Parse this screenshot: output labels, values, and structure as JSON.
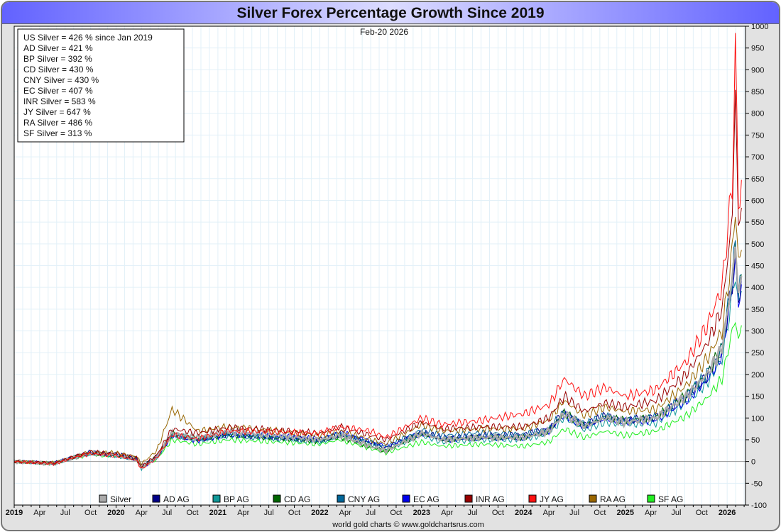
{
  "chart_data": {
    "type": "line",
    "title": "Silver Forex Percentage Growth Since 2019",
    "date_label": "Feb-20  2026",
    "footer": "world gold charts © www.goldchartsrus.com",
    "ylim": [
      -100,
      1000
    ],
    "y_ticks": [
      -100,
      -50,
      0,
      50,
      100,
      150,
      200,
      250,
      300,
      350,
      400,
      450,
      500,
      550,
      600,
      650,
      700,
      750,
      800,
      850,
      900,
      950,
      1000
    ],
    "x_range": [
      2019.0,
      2026.18
    ],
    "x_ticks": [
      {
        "v": 2019.0,
        "l": "2019",
        "b": true
      },
      {
        "v": 2019.25,
        "l": "Apr"
      },
      {
        "v": 2019.5,
        "l": "Jul"
      },
      {
        "v": 2019.75,
        "l": "Oct"
      },
      {
        "v": 2020.0,
        "l": "2020",
        "b": true
      },
      {
        "v": 2020.25,
        "l": "Apr"
      },
      {
        "v": 2020.5,
        "l": "Jul"
      },
      {
        "v": 2020.75,
        "l": "Oct"
      },
      {
        "v": 2021.0,
        "l": "2021",
        "b": true
      },
      {
        "v": 2021.25,
        "l": "Apr"
      },
      {
        "v": 2021.5,
        "l": "Jul"
      },
      {
        "v": 2021.75,
        "l": "Oct"
      },
      {
        "v": 2022.0,
        "l": "2022",
        "b": true
      },
      {
        "v": 2022.25,
        "l": "Apr"
      },
      {
        "v": 2022.5,
        "l": "Jul"
      },
      {
        "v": 2022.75,
        "l": "Oct"
      },
      {
        "v": 2023.0,
        "l": "2023",
        "b": true
      },
      {
        "v": 2023.25,
        "l": "Apr"
      },
      {
        "v": 2023.5,
        "l": "Jul"
      },
      {
        "v": 2023.75,
        "l": "Oct"
      },
      {
        "v": 2024.0,
        "l": "2024",
        "b": true
      },
      {
        "v": 2024.25,
        "l": "Apr"
      },
      {
        "v": 2024.5,
        "l": "Jul"
      },
      {
        "v": 2024.75,
        "l": "Oct"
      },
      {
        "v": 2025.0,
        "l": "2025",
        "b": true
      },
      {
        "v": 2025.25,
        "l": "Apr"
      },
      {
        "v": 2025.5,
        "l": "Jul"
      },
      {
        "v": 2025.75,
        "l": "Oct"
      },
      {
        "v": 2026.0,
        "l": "2026",
        "b": true
      }
    ],
    "info_box": [
      "US Silver = 426 % since Jan 2019",
      "AD Silver = 421 %",
      "BP Silver = 392 %",
      "CD Silver = 430 %",
      "CNY Silver = 430 %",
      "EC Silver = 407 %",
      "INR Silver = 583 %",
      "JY Silver = 647 %",
      "RA Silver = 486 %",
      "SF Silver = 313 %"
    ],
    "x": [
      2019.0,
      2019.4,
      2019.6,
      2019.75,
      2020.0,
      2020.2,
      2020.25,
      2020.4,
      2020.55,
      2020.8,
      2021.1,
      2021.6,
      2022.0,
      2022.2,
      2022.5,
      2022.65,
      2023.0,
      2023.2,
      2023.6,
      2024.0,
      2024.25,
      2024.4,
      2024.6,
      2024.8,
      2025.0,
      2025.3,
      2025.6,
      2025.8,
      2025.95,
      2026.05,
      2026.08,
      2026.11,
      2026.14
    ],
    "series": [
      {
        "name": "SF AG",
        "color": "#22ee22",
        "values": [
          0,
          -6,
          8,
          16,
          12,
          4,
          -14,
          5,
          50,
          40,
          50,
          45,
          40,
          50,
          30,
          20,
          45,
          35,
          40,
          35,
          45,
          75,
          55,
          70,
          60,
          70,
          105,
          145,
          190,
          300,
          330,
          270,
          313
        ]
      },
      {
        "name": "BP AG",
        "color": "#119999",
        "values": [
          0,
          -5,
          10,
          18,
          13,
          3,
          -16,
          8,
          62,
          50,
          60,
          52,
          45,
          62,
          40,
          28,
          60,
          45,
          50,
          50,
          65,
          100,
          72,
          90,
          85,
          88,
          135,
          180,
          235,
          380,
          440,
          350,
          392
        ]
      },
      {
        "name": "EC AG",
        "color": "#0000ee",
        "values": [
          0,
          -4,
          11,
          20,
          15,
          5,
          -15,
          8,
          60,
          48,
          62,
          58,
          52,
          68,
          45,
          35,
          65,
          50,
          55,
          55,
          70,
          108,
          80,
          98,
          92,
          95,
          140,
          185,
          245,
          395,
          460,
          360,
          407
        ]
      },
      {
        "name": "AD AG",
        "color": "#000088",
        "values": [
          0,
          -3,
          12,
          22,
          17,
          10,
          -10,
          12,
          62,
          50,
          62,
          55,
          50,
          62,
          42,
          32,
          68,
          55,
          60,
          62,
          75,
          115,
          85,
          105,
          95,
          102,
          150,
          195,
          255,
          410,
          480,
          375,
          421
        ]
      },
      {
        "name": "CD AG",
        "color": "#006600",
        "values": [
          0,
          -5,
          10,
          19,
          14,
          5,
          -14,
          12,
          64,
          52,
          62,
          54,
          46,
          56,
          34,
          24,
          64,
          50,
          55,
          55,
          70,
          112,
          82,
          102,
          94,
          102,
          152,
          200,
          262,
          420,
          500,
          385,
          430
        ]
      },
      {
        "name": "CNY AG",
        "color": "#006699",
        "values": [
          0,
          -4,
          11,
          19,
          14,
          5,
          -14,
          10,
          62,
          50,
          64,
          56,
          48,
          62,
          45,
          34,
          72,
          60,
          66,
          62,
          76,
          115,
          86,
          105,
          95,
          102,
          152,
          200,
          262,
          420,
          500,
          385,
          430
        ]
      },
      {
        "name": "Silver",
        "color": "#aaaaaa",
        "values": [
          0,
          -5,
          10,
          20,
          15,
          5,
          -15,
          10,
          65,
          55,
          70,
          60,
          50,
          60,
          35,
          25,
          65,
          50,
          55,
          55,
          70,
          110,
          80,
          100,
          90,
          100,
          150,
          200,
          260,
          420,
          500,
          380,
          426
        ]
      },
      {
        "name": "RA AG",
        "color": "#996600",
        "values": [
          0,
          -3,
          12,
          22,
          20,
          12,
          -5,
          25,
          120,
          70,
          80,
          70,
          60,
          70,
          50,
          40,
          85,
          70,
          75,
          75,
          95,
          140,
          105,
          125,
          115,
          120,
          175,
          235,
          300,
          480,
          600,
          440,
          486
        ]
      },
      {
        "name": "INR AG",
        "color": "#990000",
        "values": [
          0,
          -4,
          12,
          22,
          18,
          8,
          -12,
          15,
          75,
          65,
          78,
          72,
          65,
          80,
          60,
          50,
          90,
          75,
          80,
          80,
          100,
          150,
          115,
          135,
          125,
          140,
          200,
          270,
          350,
          560,
          860,
          540,
          583
        ]
      },
      {
        "name": "JY AG",
        "color": "#ff1111",
        "values": [
          0,
          -5,
          10,
          18,
          13,
          3,
          -17,
          8,
          62,
          52,
          70,
          68,
          65,
          80,
          70,
          55,
          100,
          85,
          95,
          110,
          130,
          190,
          150,
          170,
          150,
          165,
          230,
          310,
          400,
          640,
          940,
          600,
          647
        ]
      }
    ],
    "legend": [
      {
        "name": "Silver",
        "color": "#aaaaaa"
      },
      {
        "name": "AD AG",
        "color": "#000088"
      },
      {
        "name": "BP AG",
        "color": "#119999"
      },
      {
        "name": "CD AG",
        "color": "#006600"
      },
      {
        "name": "CNY AG",
        "color": "#006699"
      },
      {
        "name": "EC AG",
        "color": "#0000ee"
      },
      {
        "name": "INR AG",
        "color": "#990000"
      },
      {
        "name": "JY AG",
        "color": "#ff1111"
      },
      {
        "name": "RA AG",
        "color": "#996600"
      },
      {
        "name": "SF AG",
        "color": "#22ee22"
      }
    ],
    "legend_position": "bottom"
  }
}
